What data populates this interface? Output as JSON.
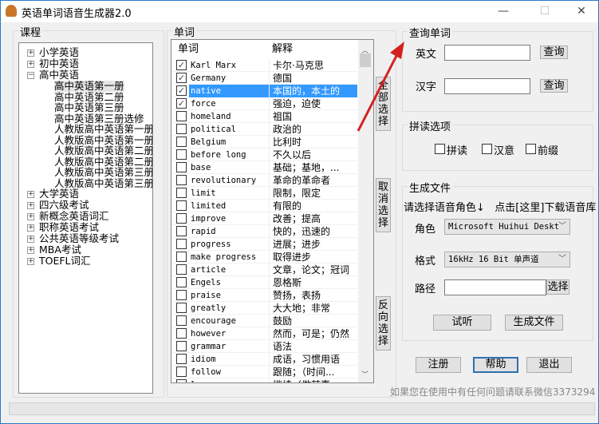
{
  "window": {
    "title": "英语单词语音生成器2.0",
    "controls": {
      "minimize": "—",
      "maximize": "☐",
      "close": "✕"
    }
  },
  "courses": {
    "label": "课程",
    "tree": [
      {
        "label": "小学英语",
        "expanded": false
      },
      {
        "label": "初中英语",
        "expanded": false
      },
      {
        "label": "高中英语",
        "expanded": true,
        "children": [
          "高中英语第一册",
          "高中英语第二册",
          "高中英语第三册",
          "高中英语第三册选修",
          "人教版高中英语第一册.",
          "人教版高中英语第一册",
          "人教版高中英语第二册.",
          "人教版高中英语第二册",
          "人教版高中英语第三册.",
          "人教版高中英语第三册"
        ]
      },
      {
        "label": "大学英语",
        "expanded": false
      },
      {
        "label": "四六级考试",
        "expanded": false
      },
      {
        "label": "新概念英语词汇",
        "expanded": false
      },
      {
        "label": "职称英语考试",
        "expanded": false
      },
      {
        "label": "公共英语等级考试",
        "expanded": false
      },
      {
        "label": "MBA考试",
        "expanded": false
      },
      {
        "label": "TOEFL词汇",
        "expanded": false
      }
    ],
    "selected": "高中英语第一册"
  },
  "words": {
    "label": "单词",
    "columns": [
      "单词",
      "解释"
    ],
    "rows": [
      {
        "word": "Karl Marx",
        "meaning": "卡尔·马克思",
        "checked": true
      },
      {
        "word": "Germany",
        "meaning": "德国",
        "checked": true
      },
      {
        "word": "native",
        "meaning": "本国的，本土的",
        "checked": true,
        "selected": true
      },
      {
        "word": "force",
        "meaning": "强迫，迫使",
        "checked": true
      },
      {
        "word": "homeland",
        "meaning": "祖国",
        "checked": false
      },
      {
        "word": "political",
        "meaning": "政治的",
        "checked": false
      },
      {
        "word": "Belgium",
        "meaning": "比利时",
        "checked": false
      },
      {
        "word": "before long",
        "meaning": "不久以后",
        "checked": false
      },
      {
        "word": "base",
        "meaning": "基础；基地，...",
        "checked": false
      },
      {
        "word": "revolutionary",
        "meaning": "革命的革命者",
        "checked": false
      },
      {
        "word": "limit",
        "meaning": "限制，限定",
        "checked": false
      },
      {
        "word": "limited",
        "meaning": "有限的",
        "checked": false
      },
      {
        "word": "improve",
        "meaning": "改善；提高",
        "checked": false
      },
      {
        "word": "rapid",
        "meaning": "快的，迅速的",
        "checked": false
      },
      {
        "word": "progress",
        "meaning": "进展；进步",
        "checked": false
      },
      {
        "word": "make progress",
        "meaning": "取得进步",
        "checked": false
      },
      {
        "word": "article",
        "meaning": "文章，论文；冠词",
        "checked": false
      },
      {
        "word": "Engels",
        "meaning": "恩格斯",
        "checked": false
      },
      {
        "word": "praise",
        "meaning": "赞扬，表扬",
        "checked": false
      },
      {
        "word": "greatly",
        "meaning": "大大地；非常",
        "checked": false
      },
      {
        "word": "encourage",
        "meaning": "鼓励",
        "checked": false
      },
      {
        "word": "however",
        "meaning": "然而，可是；仍然",
        "checked": false
      },
      {
        "word": "grammar",
        "meaning": "语法",
        "checked": false
      },
      {
        "word": "idiom",
        "meaning": "成语，习惯用语",
        "checked": false
      },
      {
        "word": "follow",
        "meaning": "跟随；（时间...",
        "checked": false
      },
      {
        "word": "l...",
        "meaning": "继续（做某事",
        "checked": false
      }
    ],
    "select_all": "全部选择",
    "deselect": "取消选择",
    "invert": "反向选择"
  },
  "query": {
    "label": "查询单词",
    "english_label": "英文",
    "english_value": "",
    "chinese_label": "汉字",
    "chinese_value": "",
    "query_button": "查询"
  },
  "spell": {
    "label": "拼读选项",
    "options": [
      {
        "label": "拼读",
        "checked": false
      },
      {
        "label": "汉意",
        "checked": false
      },
      {
        "label": "前缀",
        "checked": false
      }
    ]
  },
  "generate": {
    "label": "生成文件",
    "hint": "请选择语音角色↓   点击[这里]下载语音库",
    "role_label": "角色",
    "role_value": "Microsoft Huihui Deskt",
    "format_label": "格式",
    "format_value": "16kHz 16 Bit 单声道",
    "path_label": "路径",
    "path_value": "",
    "choose_button": "选择",
    "preview_button": "试听",
    "generate_button": "生成文件"
  },
  "actions": {
    "register": "注册",
    "help": "帮助",
    "exit": "退出"
  },
  "footer": "如果您在使用中有任何问题请联系微信3373294",
  "colors": {
    "selection": "#3399ff",
    "annotation_arrow": "#d42020"
  }
}
